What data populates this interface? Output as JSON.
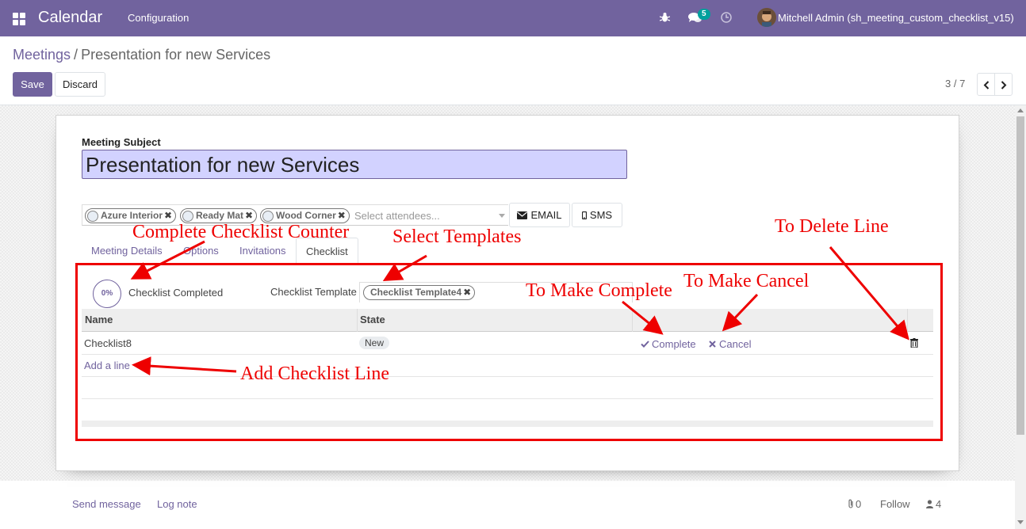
{
  "navbar": {
    "app_title": "Calendar",
    "menu": [
      "Configuration"
    ],
    "message_count": "5",
    "user_name": "Mitchell Admin (sh_meeting_custom_checklist_v15)"
  },
  "breadcrumb": {
    "parent": "Meetings",
    "separator": "/",
    "current": "Presentation for new Services"
  },
  "control_panel": {
    "save_label": "Save",
    "discard_label": "Discard",
    "pager_value": "3 / 7"
  },
  "form": {
    "subject_label": "Meeting Subject",
    "subject_value": "Presentation for new Services",
    "attendees": [
      "Azure Interior",
      "Ready Mat",
      "Wood Corner"
    ],
    "attendees_placeholder": "Select attendees...",
    "email_label": "EMAIL",
    "sms_label": "SMS",
    "tabs": [
      "Meeting Details",
      "Options",
      "Invitations",
      "Checklist"
    ],
    "active_tab": "Checklist"
  },
  "checklist": {
    "progress": "0%",
    "completed_label": "Checklist Completed",
    "template_label": "Checklist Template",
    "template_tag": "Checklist Template4",
    "columns": [
      "Name",
      "State"
    ],
    "rows": [
      {
        "name": "Checklist8",
        "state": "New",
        "complete_label": "Complete",
        "cancel_label": "Cancel"
      }
    ],
    "add_line_label": "Add a line"
  },
  "annotations": {
    "counter": "Complete Checklist Counter",
    "templates": "Select Templates",
    "delete": "To Delete Line",
    "make_cancel": "To Make Cancel",
    "make_complete": "To Make Complete",
    "add_line": "Add Checklist Line"
  },
  "chatter": {
    "send_message": "Send message",
    "log_note": "Log note",
    "attachments_count": "0",
    "follow_label": "Follow",
    "followers_count": "4"
  },
  "colors": {
    "brand": "#71639e",
    "annotation": "#ee0000",
    "badge": "#00a09d"
  }
}
